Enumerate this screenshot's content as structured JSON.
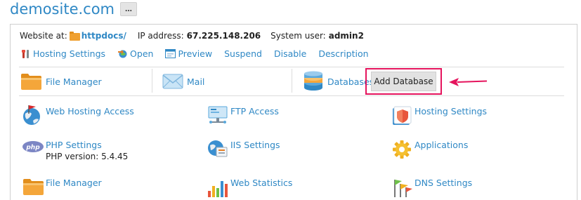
{
  "header": {
    "site_title": "demosite.com",
    "more_label": "..."
  },
  "info": {
    "website_at_label": "Website at:",
    "website_at_value": "httpdocs/",
    "ip_label": "IP address:",
    "ip_value": "67.225.148.206",
    "user_label": "System user:",
    "user_value": "admin2"
  },
  "actions": [
    {
      "label": "Hosting Settings",
      "icon": "wrench-icon"
    },
    {
      "label": "Open",
      "icon": "globe-arrow-icon"
    },
    {
      "label": "Preview",
      "icon": "preview-icon"
    },
    {
      "label": "Suspend",
      "icon": ""
    },
    {
      "label": "Disable",
      "icon": ""
    },
    {
      "label": "Description",
      "icon": ""
    }
  ],
  "tabs": [
    {
      "label": "File Manager",
      "icon": "folder-icon"
    },
    {
      "label": "Mail",
      "icon": "envelope-icon"
    },
    {
      "label": "Databases",
      "icon": "database-icon"
    }
  ],
  "add_database": {
    "label": "Add Database",
    "highlight_color": "#e5145d"
  },
  "tools": [
    {
      "label": "Web Hosting Access",
      "sub": "",
      "icon": "globe-flag-icon"
    },
    {
      "label": "FTP Access",
      "sub": "",
      "icon": "ftp-icon"
    },
    {
      "label": "Hosting Settings",
      "sub": "",
      "icon": "hosting-settings-icon"
    },
    {
      "label": "PHP Settings",
      "sub": "PHP version: 5.4.45",
      "icon": "php-icon"
    },
    {
      "label": "IIS Settings",
      "sub": "",
      "icon": "iis-icon"
    },
    {
      "label": "Applications",
      "sub": "",
      "icon": "gear-icon"
    },
    {
      "label": "File Manager",
      "sub": "",
      "icon": "folder-icon"
    },
    {
      "label": "Web Statistics",
      "sub": "",
      "icon": "bar-chart-icon"
    },
    {
      "label": "DNS Settings",
      "sub": "",
      "icon": "dns-flags-icon"
    }
  ],
  "colors": {
    "link": "#2f88c5",
    "folder": "#f0a030",
    "highlight": "#e5145d"
  }
}
